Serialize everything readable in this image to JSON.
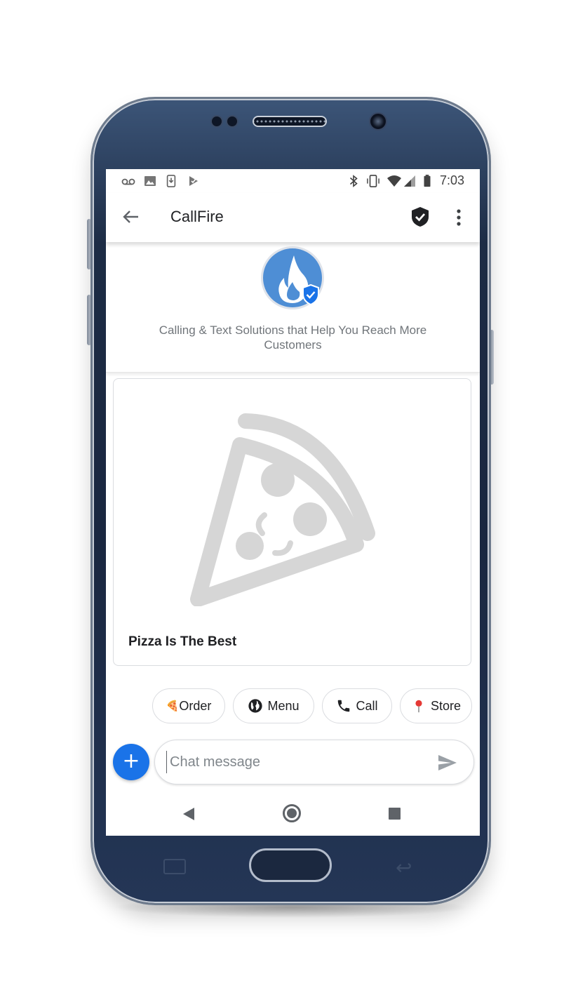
{
  "status_bar": {
    "time": "7:03",
    "left_icons": [
      "voicemail-icon",
      "image-icon",
      "download-icon",
      "play-store-icon"
    ],
    "right_icons": [
      "bluetooth-icon",
      "vibrate-icon",
      "wifi-icon",
      "signal-icon",
      "battery-icon"
    ]
  },
  "app_bar": {
    "title": "CallFire",
    "back_icon": "arrow-back-icon",
    "verified_icon": "verified-shield-icon",
    "menu_icon": "more-vert-icon"
  },
  "profile": {
    "avatar_icon": "flame-icon",
    "badge_icon": "verified-check-icon",
    "tagline": "Calling & Text Solutions that Help You Reach More Customers"
  },
  "rich_card": {
    "image_icon": "pizza-slice-icon",
    "title": "Pizza Is The Best"
  },
  "suggestions": [
    {
      "label": "Order",
      "emoji": "🍕",
      "icon": "pizza-emoji"
    },
    {
      "label": "Menu",
      "icon": "globe-icon"
    },
    {
      "label": "Call",
      "icon": "phone-icon"
    },
    {
      "label": "Store",
      "emoji": "📍",
      "icon": "pin-emoji"
    }
  ],
  "composer": {
    "add_label": "+",
    "placeholder": "Chat message",
    "value": "",
    "send_icon": "send-icon"
  },
  "nav_bar": {
    "buttons": [
      "nav-back-icon",
      "nav-home-icon",
      "nav-recents-icon"
    ]
  },
  "colors": {
    "accent": "#1a73e8",
    "avatar_bg": "#4e8ed5",
    "phone_body": "#1d2c45",
    "text_primary": "#202124",
    "text_secondary": "#70757a"
  }
}
